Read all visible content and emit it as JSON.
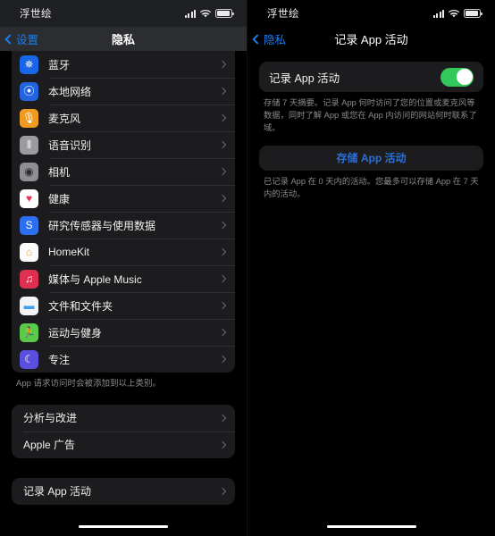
{
  "status_bar": {
    "carrier": "浮世绘",
    "icons": [
      "cellular-signal-icon",
      "wifi-icon",
      "battery-icon"
    ]
  },
  "left_screen": {
    "nav": {
      "back_label": "设置",
      "title": "隐私",
      "back_icon": "chevron-left-icon"
    },
    "privacy_list": [
      {
        "label": "蓝牙",
        "icon": "bluetooth-icon",
        "glyph": "✵",
        "bg": "#1a66e8"
      },
      {
        "label": "本地网络",
        "icon": "local-network-icon",
        "glyph": "⦿",
        "bg": "#2263e0"
      },
      {
        "label": "麦克风",
        "icon": "microphone-icon",
        "glyph": "🎙",
        "bg": "#f09a21"
      },
      {
        "label": "语音识别",
        "icon": "speech-recognition-icon",
        "glyph": "⦀",
        "bg": "#9a9aa0"
      },
      {
        "label": "相机",
        "icon": "camera-icon",
        "glyph": "◉",
        "bg": "#8e8e93"
      },
      {
        "label": "健康",
        "icon": "health-icon",
        "glyph": "♥",
        "bg": "#ffffff"
      },
      {
        "label": "研究传感器与使用数据",
        "icon": "research-sensor-icon",
        "glyph": "S",
        "bg": "#2c6ff0"
      },
      {
        "label": "HomeKit",
        "icon": "homekit-icon",
        "glyph": "⌂",
        "bg": "#fbfbfb"
      },
      {
        "label": "媒体与 Apple Music",
        "icon": "apple-music-icon",
        "glyph": "♫",
        "bg": "#e03050"
      },
      {
        "label": "文件和文件夹",
        "icon": "files-folders-icon",
        "glyph": "▬",
        "bg": "#f4f4f6"
      },
      {
        "label": "运动与健身",
        "icon": "fitness-icon",
        "glyph": "🏃",
        "bg": "#5bc94a"
      },
      {
        "label": "专注",
        "icon": "focus-icon",
        "glyph": "☾",
        "bg": "#5b4fe0"
      }
    ],
    "privacy_footnote": "App 请求访问时会被添加到以上类别。",
    "second_group": [
      {
        "label": "分析与改进"
      },
      {
        "label": "Apple 广告"
      }
    ],
    "third_group": [
      {
        "label": "记录 App 活动"
      }
    ]
  },
  "right_screen": {
    "nav": {
      "back_label": "隐私",
      "title": "记录 App 活动",
      "back_icon": "chevron-left-icon"
    },
    "toggle": {
      "label": "记录 App 活动",
      "state": "on",
      "on_color": "#34c759"
    },
    "toggle_description": "存储 7 天摘要。记录 App 何时访问了您的位置或麦克风等数据，同时了解 App 或您在 App 内访问的网站何时联系了域。",
    "save_button": {
      "label": "存储 App 活动",
      "color": "#2a6fd6"
    },
    "save_description": "已记录 App 在 0 天内的活动。您最多可以存储 App 在 7 天内的活动。"
  },
  "home_indicator": "home-indicator"
}
